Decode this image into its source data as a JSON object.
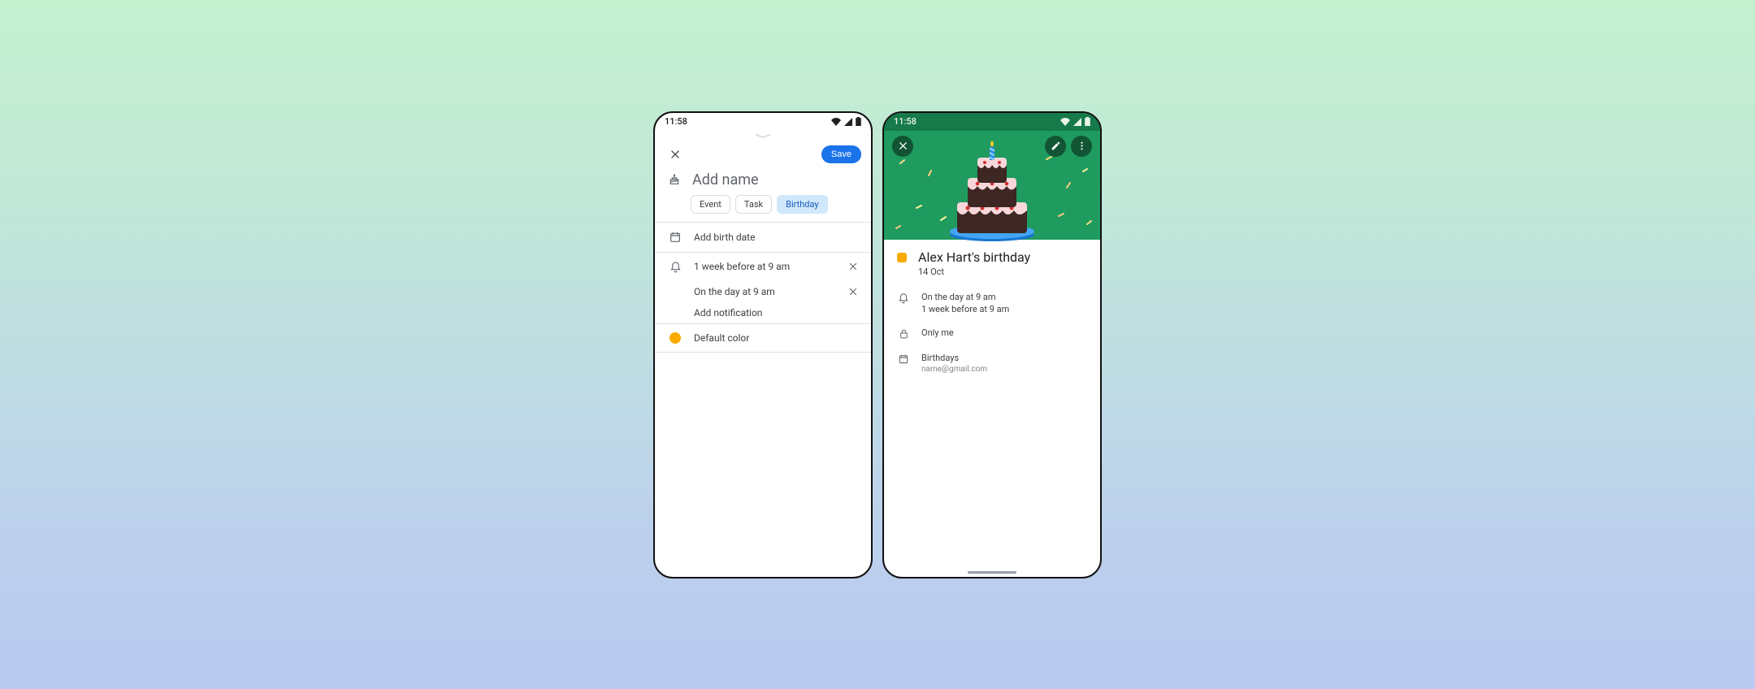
{
  "status_time": "11:58",
  "create": {
    "save_label": "Save",
    "title_placeholder": "Add name",
    "chips": {
      "event": "Event",
      "task": "Task",
      "birthday": "Birthday"
    },
    "birth_date": "Add birth date",
    "notif1": "1 week before at 9 am",
    "notif2": "On the day at 9 am",
    "add_notif": "Add notification",
    "color_label": "Default color",
    "color_value": "#f9ab00"
  },
  "view": {
    "title": "Alex Hart's birthday",
    "date": "14 Oct",
    "notif1": "On the day at 9 am",
    "notif2": "1 week before at 9 am",
    "visibility": "Only me",
    "calendar": "Birthdays",
    "account": "name@gmail.com",
    "dot_color": "#f9ab00"
  }
}
